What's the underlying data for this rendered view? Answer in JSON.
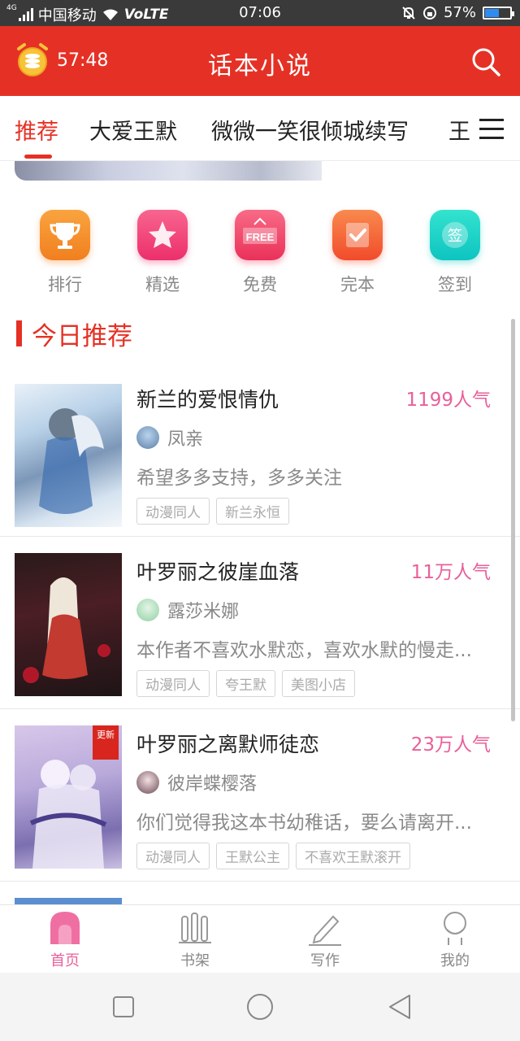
{
  "status_bar": {
    "net": "4G",
    "carrier": "中国移动",
    "volte": "VoLTE",
    "time": "07:06",
    "battery": "57%",
    "battery_level": 0.57
  },
  "header": {
    "timer": "57:48",
    "title": "话本小说"
  },
  "tabs": [
    {
      "label": "推荐",
      "active": true
    },
    {
      "label": "大爱王默",
      "active": false
    },
    {
      "label": "微微一笑很倾城续写",
      "active": false
    },
    {
      "label": "王昭",
      "active": false
    }
  ],
  "quick_links": [
    {
      "label": "排行",
      "icon": "trophy-icon",
      "color": "#f5922b"
    },
    {
      "label": "精选",
      "icon": "star-icon",
      "color": "#f0457d"
    },
    {
      "label": "免费",
      "icon": "free-tag-icon",
      "color": "#f0466a"
    },
    {
      "label": "完本",
      "icon": "check-icon",
      "color": "#f4613a"
    },
    {
      "label": "签到",
      "icon": "sign-in-icon",
      "color": "#1fd3c4"
    }
  ],
  "quick_free_text": "FREE",
  "quick_sign_text": "签",
  "section": {
    "title": "今日推荐"
  },
  "books": [
    {
      "title": "新兰的爱恨情仇",
      "popularity": "1199人气",
      "author": "凤亲",
      "description": "希望多多支持，多多关注",
      "tags": [
        "动漫同人",
        "新兰永恒"
      ],
      "update_badge": ""
    },
    {
      "title": "叶罗丽之彼崖血落",
      "popularity": "11万人气",
      "author": "露莎米娜",
      "description": "本作者不喜欢水默恋，喜欢水默的慢走...",
      "tags": [
        "动漫同人",
        "夸王默",
        "美图小店"
      ],
      "update_badge": ""
    },
    {
      "title": "叶罗丽之离默师徒恋",
      "popularity": "23万人气",
      "author": "彼岸蝶樱落",
      "description": "你们觉得我这本书幼稚话，要么请离开...",
      "tags": [
        "动漫同人",
        "王默公主",
        "不喜欢王默滚开"
      ],
      "update_badge": "更新"
    }
  ],
  "bottom_nav": [
    {
      "label": "首页",
      "icon": "home-icon",
      "active": true
    },
    {
      "label": "书架",
      "icon": "bookshelf-icon",
      "active": false
    },
    {
      "label": "写作",
      "icon": "pencil-icon",
      "active": false
    },
    {
      "label": "我的",
      "icon": "profile-icon",
      "active": false
    }
  ],
  "colors": {
    "brand_red": "#e53125",
    "popularity_pink": "#e8609a"
  }
}
